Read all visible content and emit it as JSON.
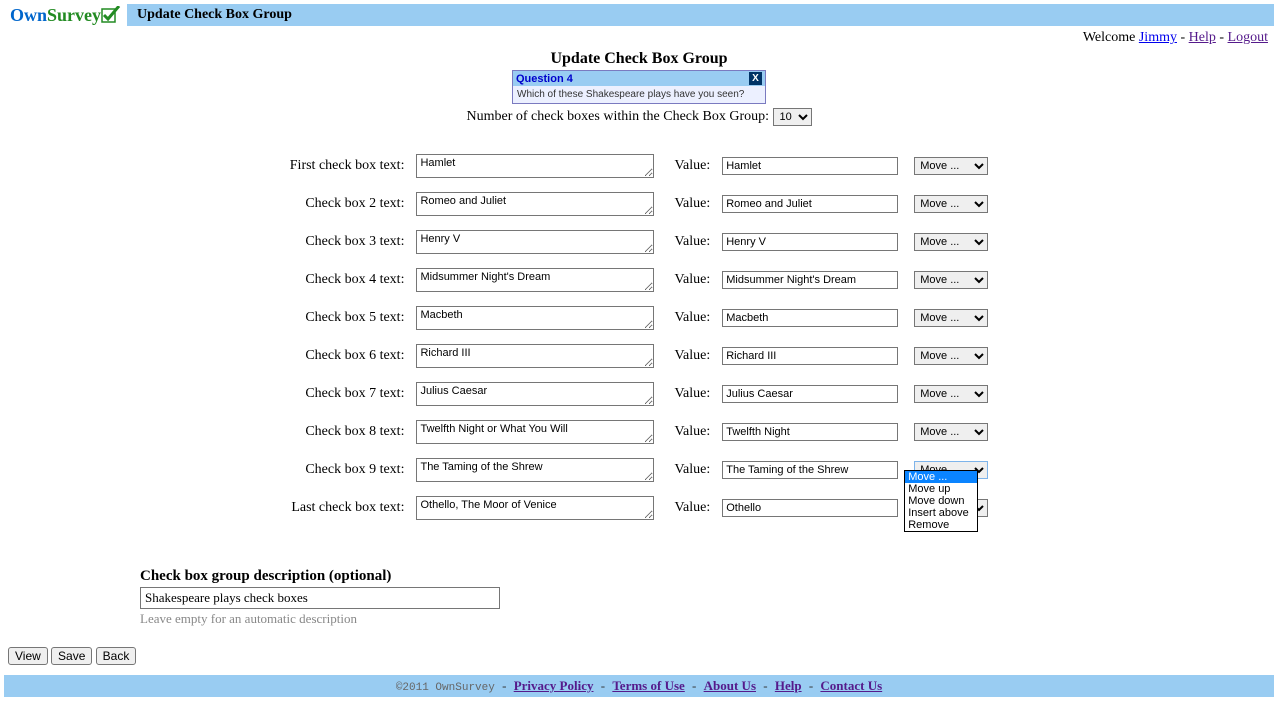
{
  "header": {
    "logo_own": "Own",
    "logo_survey": " Survey",
    "title": "Update Check Box Group"
  },
  "welcome": {
    "prefix": "Welcome ",
    "user": "Jimmy",
    "help": "Help",
    "logout": "Logout"
  },
  "page_title": "Update Check Box Group",
  "question": {
    "header": "Question 4",
    "close": "X",
    "body": "Which of these Shakespeare plays have you seen?"
  },
  "num_row": {
    "label": "Number of check boxes within the Check Box Group:",
    "value": "10"
  },
  "rows": [
    {
      "label": "First check box text:",
      "text": "Hamlet",
      "value": "Hamlet",
      "move": "Move ..."
    },
    {
      "label": "Check box 2 text:",
      "text": "Romeo and Juliet",
      "value": "Romeo and Juliet",
      "move": "Move ..."
    },
    {
      "label": "Check box 3 text:",
      "text": "Henry V",
      "value": "Henry V",
      "move": "Move ..."
    },
    {
      "label": "Check box 4 text:",
      "text": "Midsummer Night's Dream",
      "value": "Midsummer Night's Dream",
      "move": "Move ..."
    },
    {
      "label": "Check box 5 text:",
      "text": "Macbeth",
      "value": "Macbeth",
      "move": "Move ..."
    },
    {
      "label": "Check box 6 text:",
      "text": "Richard III",
      "value": "Richard III",
      "move": "Move ..."
    },
    {
      "label": "Check box 7 text:",
      "text": "Julius Caesar",
      "value": "Julius Caesar",
      "move": "Move ..."
    },
    {
      "label": "Check box 8 text:",
      "text": "Twelfth Night or What You Will",
      "value": "Twelfth Night",
      "move": "Move ..."
    },
    {
      "label": "Check box 9 text:",
      "text": "The Taming of the Shrew",
      "value": "The Taming of the Shrew",
      "move": "Move ...",
      "open": true
    },
    {
      "label": "Last check box text:",
      "text": "Othello, The Moor of Venice",
      "value": "Othello",
      "move": "Move ..."
    }
  ],
  "value_label": "Value:",
  "dropdown_options": [
    "Move ...",
    "Move up",
    "Move down",
    "Insert above",
    "Remove"
  ],
  "desc": {
    "title": "Check box group description (optional)",
    "value": "Shakespeare plays check boxes",
    "hint": "Leave empty for an automatic description"
  },
  "buttons": {
    "view": "View",
    "save": "Save",
    "back": "Back"
  },
  "footer": {
    "copy": "©2011 OwnSurvey",
    "privacy": "Privacy Policy",
    "terms": "Terms of Use",
    "about": "About Us",
    "help": "Help",
    "contact": "Contact Us"
  }
}
